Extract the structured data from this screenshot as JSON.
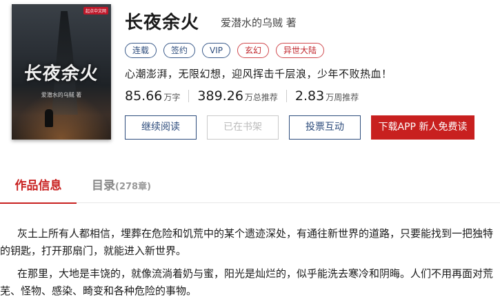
{
  "book": {
    "title": "长夜余火",
    "author": "爱潜水的乌贼 著",
    "cover_title": "长夜余火",
    "cover_author": "爱潜水的乌贼 著",
    "cover_badge": "起点中文网",
    "tags": [
      {
        "label": "连载",
        "style": "blue"
      },
      {
        "label": "签约",
        "style": "blue"
      },
      {
        "label": "VIP",
        "style": "blue"
      },
      {
        "label": "玄幻",
        "style": "red"
      },
      {
        "label": "异世大陆",
        "style": "red"
      }
    ],
    "intro": "心潮澎湃，无限幻想，迎风挥击千层浪，少年不败热血！",
    "stats": [
      {
        "value": "85.66",
        "unit": "万字"
      },
      {
        "value": "389.26",
        "unit": "万总推荐"
      },
      {
        "value": "2.83",
        "unit": "万周推荐"
      }
    ]
  },
  "buttons": {
    "read": "继续阅读",
    "shelf": "已在书架",
    "vote": "投票互动",
    "download": "下载APP 新人免费读"
  },
  "tabs": {
    "info": "作品信息",
    "toc": "目录",
    "toc_count": "(278章)"
  },
  "description": {
    "p1": "灰土上所有人都相信，埋葬在危险和饥荒中的某个遗迹深处，有通往新世界的道路，只要能找到一把独特的钥匙，打开那扇门，就能进入新世界。",
    "p2": "在那里，大地是丰饶的，就像流淌着奶与蜜，阳光是灿烂的，似乎能洗去寒冷和阴晦。人们不用再面对荒芜、怪物、感染、畸变和各种危险的事物。"
  },
  "colors": {
    "accent_red": "#c8201f",
    "tag_blue": "#2d4c7c"
  }
}
